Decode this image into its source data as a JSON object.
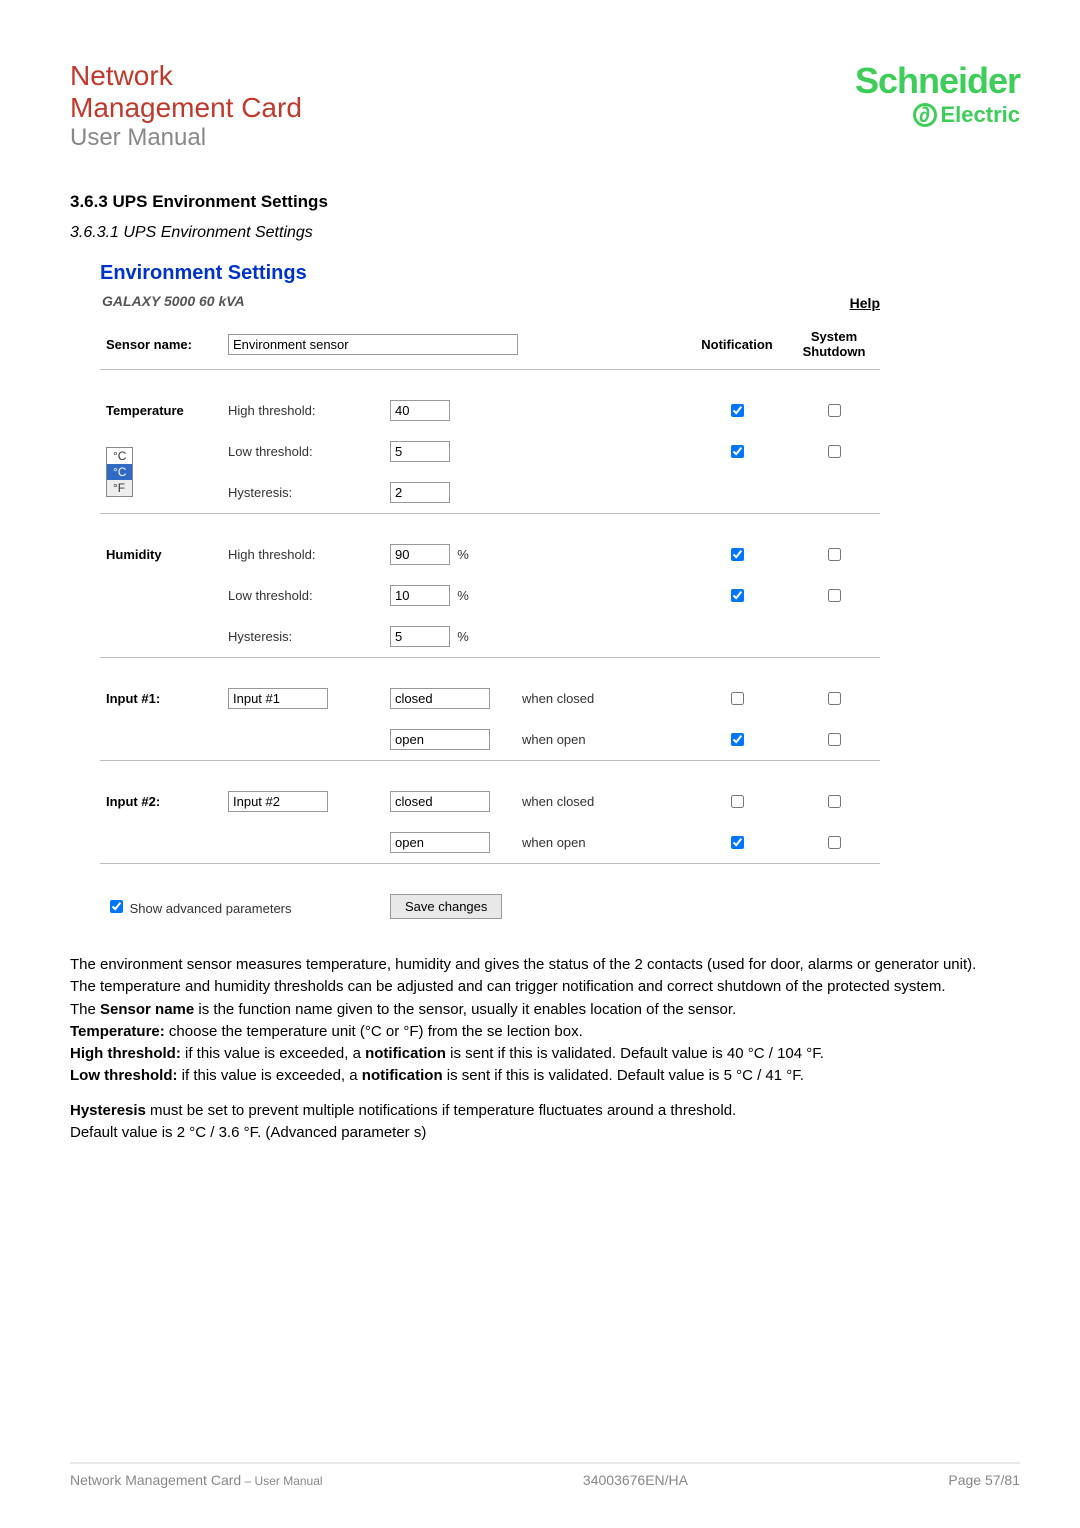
{
  "header": {
    "line1": "Network",
    "line2": "Management Card",
    "line3": "User Manual",
    "logo_top": "Schneider",
    "logo_bottom": "Electric"
  },
  "section": {
    "num_title": "3.6.3   UPS Environment Settings",
    "sub": "3.6.3.1   UPS Environment Settings",
    "panel_title": "Environment Settings",
    "device": "GALAXY 5000 60 kVA",
    "help": "Help"
  },
  "form": {
    "col_sensor": "Sensor name:",
    "col_notif": "Notification",
    "col_shutdown": "System Shutdown",
    "sensor_name": "Environment sensor",
    "temperature_label": "Temperature",
    "unit_options": {
      "c": "°C",
      "f": "°F"
    },
    "high_threshold": "High threshold:",
    "low_threshold": "Low threshold:",
    "hysteresis": "Hysteresis:",
    "temp_high": "40",
    "temp_low": "5",
    "temp_hyst": "2",
    "humidity_label": "Humidity",
    "hum_high": "90",
    "hum_low": "10",
    "hum_hyst": "5",
    "pct": "%",
    "input1_label": "Input #1:",
    "input1_name": "Input #1",
    "input2_label": "Input #2:",
    "input2_name": "Input #2",
    "closed": "closed",
    "open": "open",
    "when_closed": "when closed",
    "when_open": "when open",
    "show_advanced": "Show advanced parameters",
    "save": "Save changes",
    "checks": {
      "temp_high_notif": true,
      "temp_high_shut": false,
      "temp_low_notif": true,
      "temp_low_shut": false,
      "hum_high_notif": true,
      "hum_high_shut": false,
      "hum_low_notif": true,
      "hum_low_shut": false,
      "in1_closed_notif": false,
      "in1_closed_shut": false,
      "in1_open_notif": true,
      "in1_open_shut": false,
      "in2_closed_notif": false,
      "in2_closed_shut": false,
      "in2_open_notif": true,
      "in2_open_shut": false,
      "show_adv": true
    }
  },
  "body": {
    "p1": "The environment sensor measures temperature, humidity and gives the status of the 2 contacts (used for door, alarms or generator unit).",
    "p2": "The temperature and humidity thresholds can be adjusted and can trigger notification and correct shutdown of the protected system.",
    "p3a": "The ",
    "p3b": "Sensor name",
    "p3c": " is the function name given to the sensor, usually it enables location of the sensor.",
    "p4a": "Temperature:",
    "p4b": " choose the temperature unit (°C or °F)  from the se  lection box.",
    "p5a": "High threshold:",
    "p5b": " if this value is exceeded, a ",
    "p5c": "notification",
    "p5d": " is sent if this is validated. Default value is 40 °C / 104 °F.",
    "p6a": "Low threshold:",
    "p6b": " if this value is exceeded, a ",
    "p6c": "notification",
    "p6d": " is sent if this is validated. Default value is 5 °C / 41 °F.",
    "p7a": "Hysteresis",
    "p7b": " must be set to prevent multiple notifications if temperature fluctuates around a threshold.",
    "p8": "Default value is 2 °C / 3.6 °F. (Advanced parameter  s)"
  },
  "footer": {
    "left1": "Network Management Card",
    "left2": " – User Manual",
    "mid": "34003676EN/HA",
    "right": "Page 57/81"
  }
}
